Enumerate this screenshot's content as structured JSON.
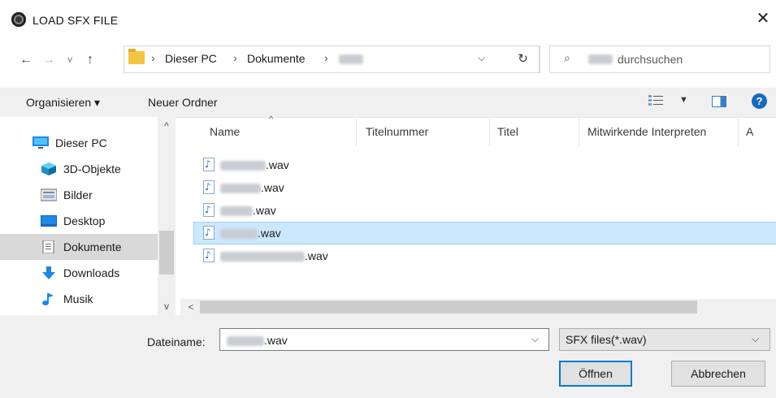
{
  "window": {
    "title": "LOAD SFX FILE",
    "close_glyph": "✕"
  },
  "nav": {
    "back_glyph": "←",
    "forward_glyph": "→",
    "recent_glyph": "˅",
    "up_glyph": "↑",
    "breadcrumb": [
      "Dieser PC",
      "Dokumente"
    ],
    "crumb_sep": "›",
    "refresh_glyph": "↻",
    "search_placeholder_suffix": "durchsuchen"
  },
  "toolbar": {
    "organize_label": "Organisieren ▾",
    "new_folder_label": "Neuer Ordner",
    "help_glyph": "?"
  },
  "sidebar": {
    "items": [
      {
        "label": "Dieser PC",
        "icon": "pc-icon"
      },
      {
        "label": "3D-Objekte",
        "icon": "cube-icon"
      },
      {
        "label": "Bilder",
        "icon": "pictures-icon"
      },
      {
        "label": "Desktop",
        "icon": "desktop-icon"
      },
      {
        "label": "Dokumente",
        "icon": "documents-icon",
        "selected": true
      },
      {
        "label": "Downloads",
        "icon": "download-icon"
      },
      {
        "label": "Musik",
        "icon": "music-icon"
      }
    ]
  },
  "columns": [
    "Name",
    "Titelnummer",
    "Titel",
    "Mitwirkende Interpreten",
    "A"
  ],
  "files": [
    {
      "suffix": ".wav"
    },
    {
      "suffix": ".wav"
    },
    {
      "suffix": ".wav"
    },
    {
      "suffix": ".wav",
      "selected": true
    },
    {
      "suffix": ".wav"
    }
  ],
  "footer": {
    "filename_label": "Dateiname:",
    "filename_suffix": ".wav",
    "filetype": "SFX files(*.wav)",
    "open_label": "Öffnen",
    "cancel_label": "Abbrechen"
  },
  "colors": {
    "accent": "#0078d7",
    "selection": "#cce8ff",
    "folder": "#f4c542"
  }
}
